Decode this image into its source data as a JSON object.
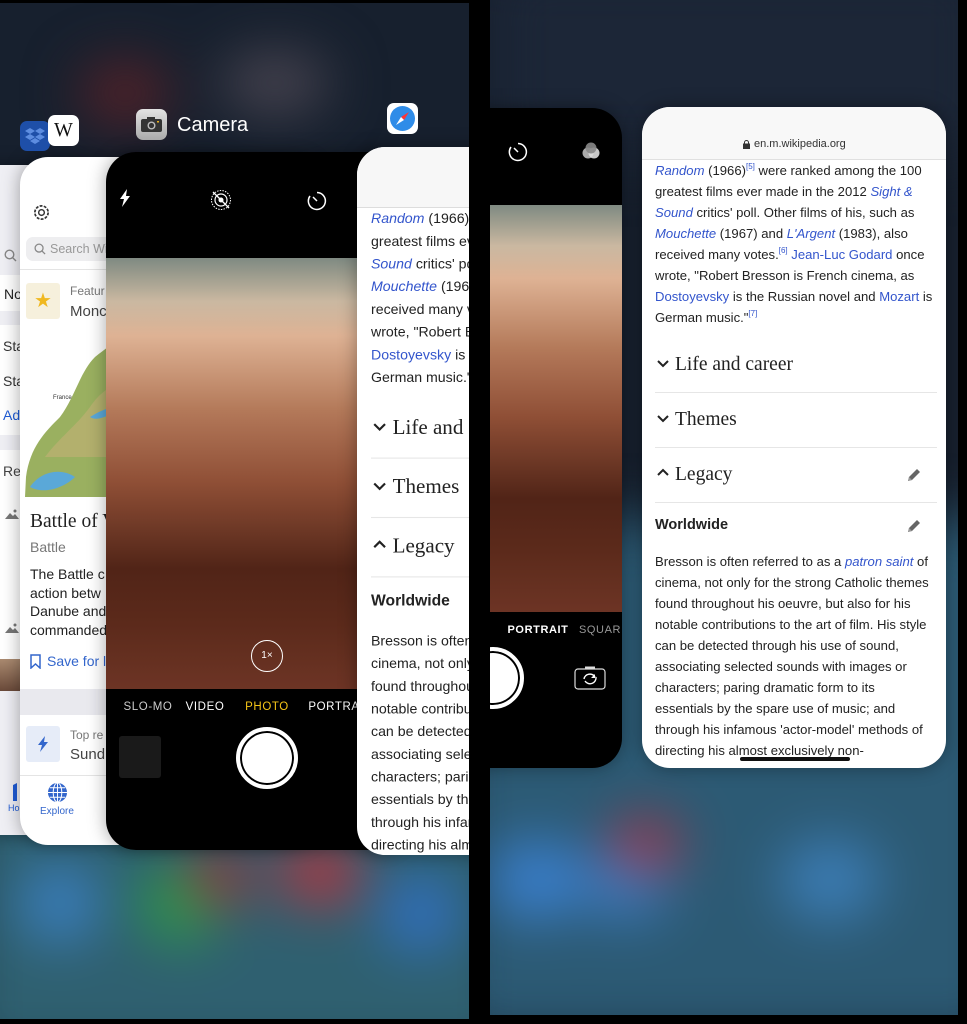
{
  "left_screen": {
    "app_labels": {
      "camera": "Camera"
    },
    "far_left_app": {
      "items": [
        "No",
        "Sta",
        "Sta",
        "Ad",
        "Re"
      ],
      "tab_home": "Ho"
    },
    "wikipedia_app": {
      "search_placeholder": "Search Wi",
      "featured_label": "Featur",
      "featured_title": "Monc",
      "map_label": "France",
      "article_title": "Battle of V",
      "article_subtitle": "Battle",
      "article_lines": [
        "The Battle c",
        "action betw",
        "Danube and",
        "commanded"
      ],
      "save_label": "Save for l",
      "top_read_label": "Top re",
      "top_read_title": "Sund",
      "tab_explore": "Explore"
    },
    "camera": {
      "modes": [
        "SLO-MO",
        "VIDEO",
        "PHOTO",
        "PORTRA"
      ],
      "selected_mode": "PHOTO",
      "zoom": "1×"
    }
  },
  "right_screen": {
    "camera": {
      "modes": [
        "PORTRAIT",
        "SQUAR"
      ]
    },
    "safari": {
      "url": "en.m.wikipedia.org"
    }
  },
  "article": {
    "intro": [
      [
        {
          "t": "Random",
          "link": true,
          "italic": true
        },
        {
          "t": " (1966)"
        },
        {
          "sup": "[5]"
        },
        {
          "t": " were ranked among the 100"
        }
      ],
      [
        {
          "t": "greatest films ever made in the 2012 "
        },
        {
          "t": "Sight &",
          "link": true,
          "italic": true
        }
      ],
      [
        {
          "t": "Sound",
          "link": true,
          "italic": true
        },
        {
          "t": " critics' poll. Other films of his, such as"
        }
      ],
      [
        {
          "t": "Mouchette",
          "link": true,
          "italic": true
        },
        {
          "t": " (1967) and "
        },
        {
          "t": "L'Argent",
          "link": true,
          "italic": true
        },
        {
          "t": " (1983), also"
        }
      ],
      [
        {
          "t": "received many votes."
        },
        {
          "sup": "[6]"
        },
        {
          "t": " "
        },
        {
          "t": "Jean-Luc Godard",
          "link": true
        },
        {
          "t": " once"
        }
      ],
      [
        {
          "t": "wrote, \"Robert Bresson is French cinema, as"
        }
      ],
      [
        {
          "t": "Dostoyevsky",
          "link": true
        },
        {
          "t": " is the Russian novel and "
        },
        {
          "t": "Mozart",
          "link": true
        },
        {
          "t": " is"
        }
      ],
      [
        {
          "t": "German music.\""
        },
        {
          "sup": "[7]"
        }
      ]
    ],
    "sections": [
      {
        "title": "Life and career",
        "expanded": false,
        "editable": false
      },
      {
        "title": "Themes",
        "expanded": false,
        "editable": false
      },
      {
        "title": "Legacy",
        "expanded": true,
        "editable": true
      }
    ],
    "subsection": "Worldwide",
    "paragraph": [
      [
        {
          "t": "Bresson is often referred to as a "
        },
        {
          "t": "patron saint",
          "link": true,
          "italic": true
        },
        {
          "t": " of"
        }
      ],
      [
        {
          "t": "cinema, not only for the strong Catholic themes"
        }
      ],
      [
        {
          "t": "found throughout his oeuvre, but also for his"
        }
      ],
      [
        {
          "t": "notable contributions to the art of film. His style"
        }
      ],
      [
        {
          "t": "can be detected through his use of sound,"
        }
      ],
      [
        {
          "t": "associating selected sounds with images or"
        }
      ],
      [
        {
          "t": "characters; paring dramatic form to its"
        }
      ],
      [
        {
          "t": "essentials by the spare use of music; and"
        }
      ],
      [
        {
          "t": "through his infamous 'actor-model' methods of"
        }
      ],
      [
        {
          "t": "directing his almost exclusively non-"
        }
      ]
    ]
  },
  "colors": {
    "link": "#3355cc",
    "camera_selected_mode": "#f5c518",
    "wikipedia_app_accent": "#3366cc",
    "dropbox_blue": "#1e5bd6"
  }
}
